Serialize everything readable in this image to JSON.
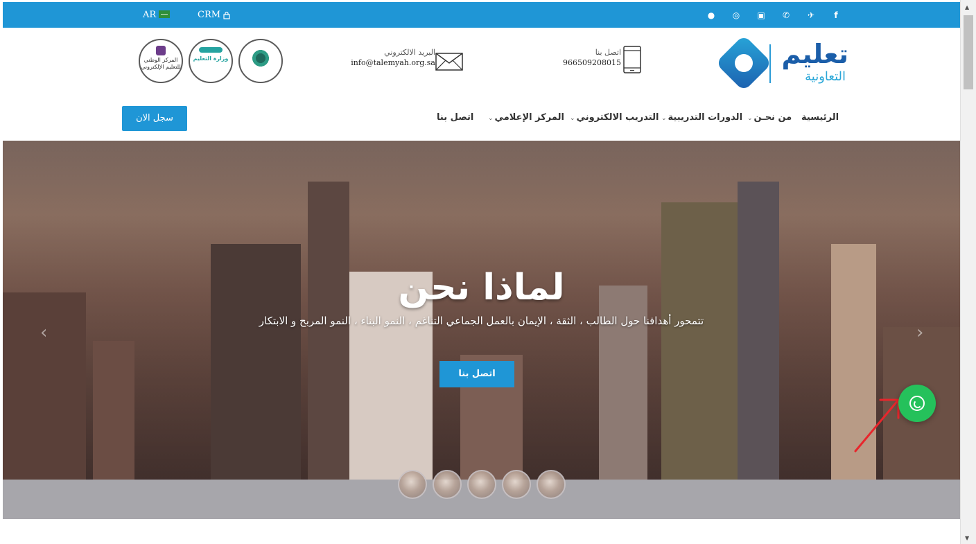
{
  "topbar": {
    "lang": "AR",
    "crm": "CRM",
    "social_icons": [
      "snapchat-icon",
      "instagram-icon",
      "youtube-icon",
      "whatsapp-icon",
      "twitter-icon",
      "facebook-icon"
    ]
  },
  "header": {
    "email_label": "البريد الالكتروني",
    "email_value": "info@talemyah.org.sa",
    "phone_label": "اتصل بنا",
    "phone_value": "966509208015",
    "brand_line1": "تعليم",
    "brand_line2": "التعاونية",
    "seal1_text": "المركز الوطني للتعليم الإلكتروني",
    "seal2_text": "وزارة التعليم",
    "seal3_text": ""
  },
  "nav": {
    "items": [
      {
        "label": "الرئيسية",
        "dropdown": false
      },
      {
        "label": "من نحـن",
        "dropdown": true
      },
      {
        "label": "الدورات التدريبية",
        "dropdown": true
      },
      {
        "label": "التدريب الالكتروني",
        "dropdown": true
      },
      {
        "label": "المركز الإعلامي",
        "dropdown": true
      },
      {
        "label": "اتصل بنا",
        "dropdown": false
      }
    ],
    "register_label": "سجل الان"
  },
  "hero": {
    "title": "لماذا نحن",
    "subtitle": "تتمحور أهدافنا حول الطالب ، الثقة ، الإيمان بالعمل الجماعي التناغم ، النمو البناء ، النمو المربح و الابتكار",
    "cta_label": "اتصل بنا",
    "prev_arrow": "‹",
    "next_arrow": "›"
  },
  "colors": {
    "primary": "#1f96d6",
    "brand_dark": "#1b5ea9",
    "whatsapp": "#25c15b",
    "strip": "#a7a6ab"
  }
}
